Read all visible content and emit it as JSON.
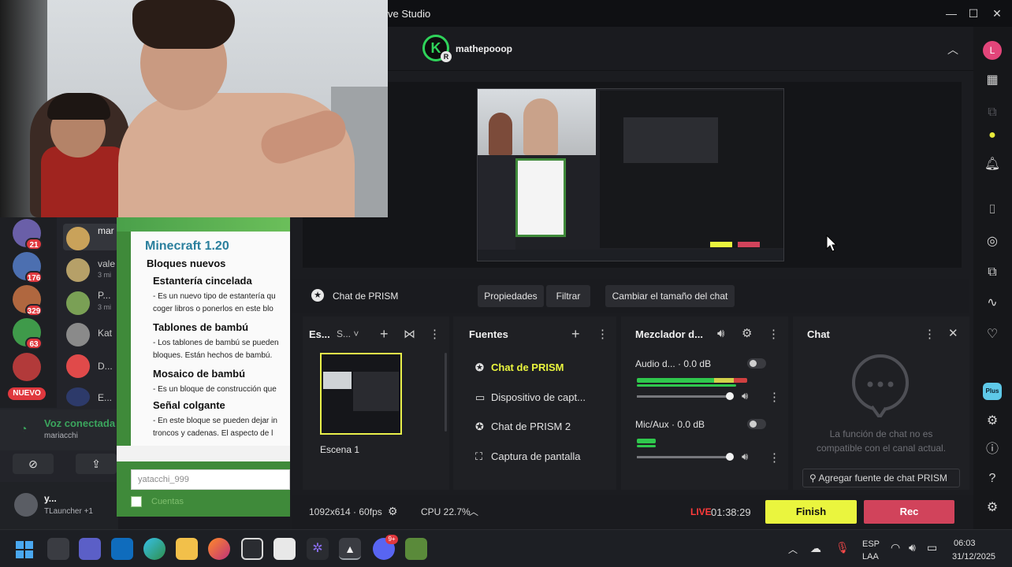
{
  "window": {
    "title": "ve Studio"
  },
  "account": {
    "name": "mathepooop",
    "avatar_letter": "K",
    "profile_letter": "L"
  },
  "toolbar": {
    "source_label": "Chat de PRISM",
    "properties": "Propiedades",
    "filter": "Filtrar",
    "resize_chat": "Cambiar el tamaño del chat"
  },
  "scenes": {
    "title": "Es...",
    "sub": "S...",
    "items": [
      "Escena 1"
    ]
  },
  "sources": {
    "title": "Fuentes",
    "items": [
      {
        "label": "Chat de PRISM",
        "icon": "star-icon",
        "active": true
      },
      {
        "label": "Dispositivo de capt...",
        "icon": "camera-icon"
      },
      {
        "label": "Chat de PRISM 2",
        "icon": "star-icon"
      },
      {
        "label": "Captura de pantalla",
        "icon": "screen-capture-icon"
      }
    ]
  },
  "mixer": {
    "title": "Mezclador d...",
    "channels": [
      {
        "name": "Audio d...",
        "db": "0.0 dB"
      },
      {
        "name": "Mic/Aux",
        "db": "0.0 dB"
      }
    ]
  },
  "chat": {
    "title": "Chat",
    "message": "La función de chat no es compatible con el canal actual.",
    "add_source": "Agregar fuente de chat PRISM"
  },
  "status": {
    "resolution": "1092x614 · 60fps",
    "cpu": "CPU 22.7%",
    "live_label": "LIVE",
    "timer": "01:38:29",
    "finish": "Finish",
    "rec": "Rec"
  },
  "discord": {
    "badges": [
      "21",
      "176",
      "329",
      "63"
    ],
    "new_label": "NUEVO",
    "members": [
      {
        "name": "mar",
        "sub": ""
      },
      {
        "name": "vale",
        "sub": "3 mi"
      },
      {
        "name": "P...",
        "sub": "3 mi"
      },
      {
        "name": "Kat",
        "sub": ""
      },
      {
        "name": "D...",
        "sub": ""
      },
      {
        "name": "E...",
        "sub": ""
      }
    ],
    "voice_status": "Voz conectada",
    "voice_channel": "mariacchi",
    "user_name": "y...",
    "user_activity": "TLauncher +1"
  },
  "minecraft": {
    "title": "Minecraft 1.20",
    "section": "Bloques nuevos",
    "items": [
      {
        "heading": "Estantería cincelada",
        "lines": [
          "- Es un nuevo tipo de estantería qu",
          "coger libros o ponerlos en este blo"
        ]
      },
      {
        "heading": "Tablones de bambú",
        "lines": [
          "- Los tablones de bambú se pueden",
          "bloques. Están hechos de bambú."
        ]
      },
      {
        "heading": "Mosaico de bambú",
        "lines": [
          "- Es un bloque de construcción que"
        ]
      },
      {
        "heading": "Señal colgante",
        "lines": [
          "- En este bloque se pueden dejar in",
          "troncos y cadenas. El aspecto de l"
        ]
      }
    ],
    "input_value": "yatacchi_999",
    "checkbox_label": "Cuentas"
  },
  "taskbar": {
    "lang": "ESP",
    "lang_sub": "LAA",
    "time": "06:03",
    "date": "31/12/2025",
    "discord_badge": "9+"
  },
  "colors": {
    "accent_yellow": "#eaf53e",
    "rec_red": "#d1435b",
    "live_red": "#ff3b3b",
    "prism_green": "#2fd35a"
  }
}
